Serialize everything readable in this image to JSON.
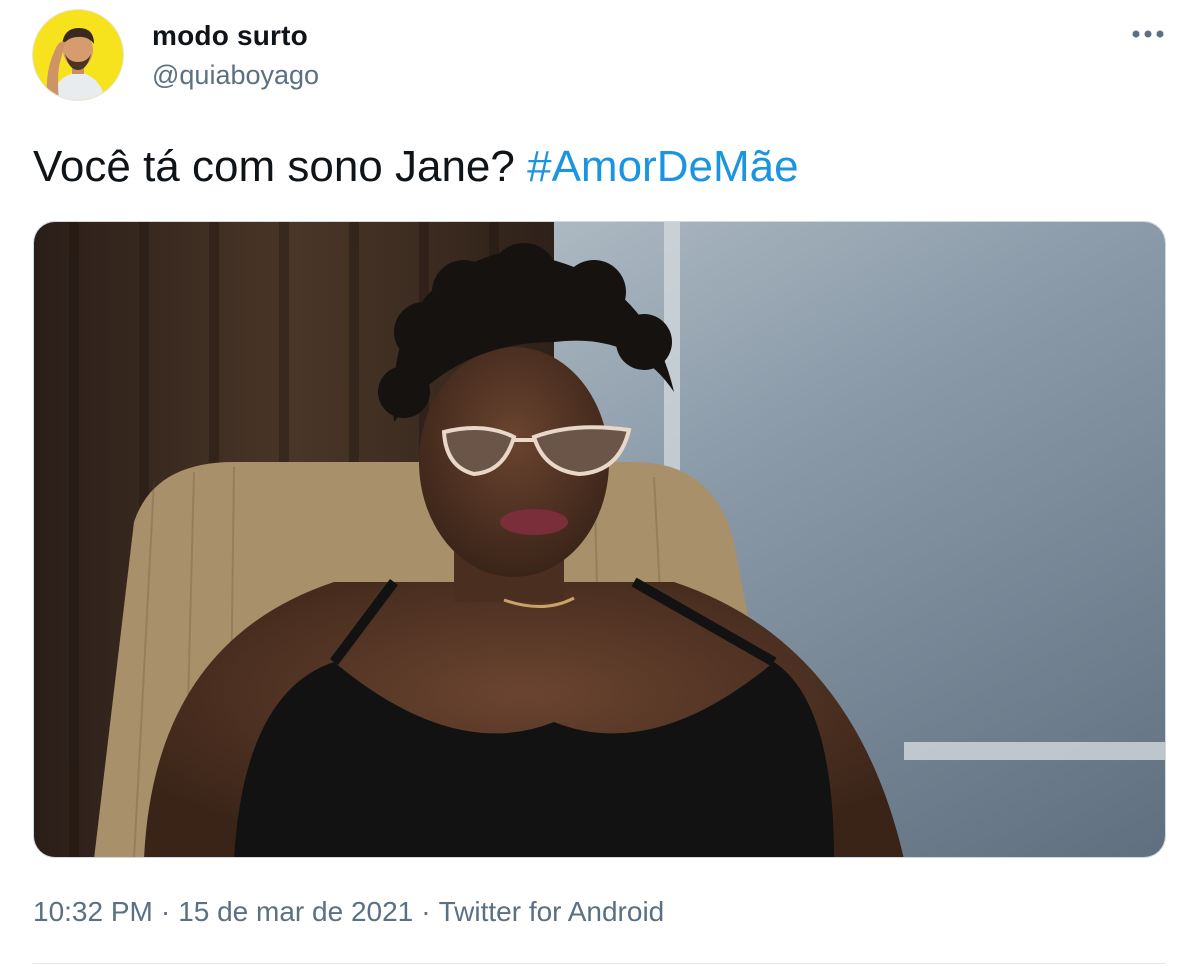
{
  "author": {
    "display_name": "modo surto",
    "handle": "@quiaboyago",
    "avatar_icon": "avatar-photo"
  },
  "more_icon": "more-horizontal-icon",
  "tweet": {
    "text": "Você tá com sono Jane?",
    "hashtag": "#AmorDeMãe",
    "media_description_icon": "photo"
  },
  "meta": {
    "time": "10:32 PM",
    "date": "15 de mar de 2021",
    "source": "Twitter for Android",
    "separator": "·"
  },
  "colors": {
    "accent": "#1b95e0",
    "secondary_text": "#5b7083",
    "primary_text": "#0f1419",
    "avatar_bg": "#f7e31d"
  }
}
